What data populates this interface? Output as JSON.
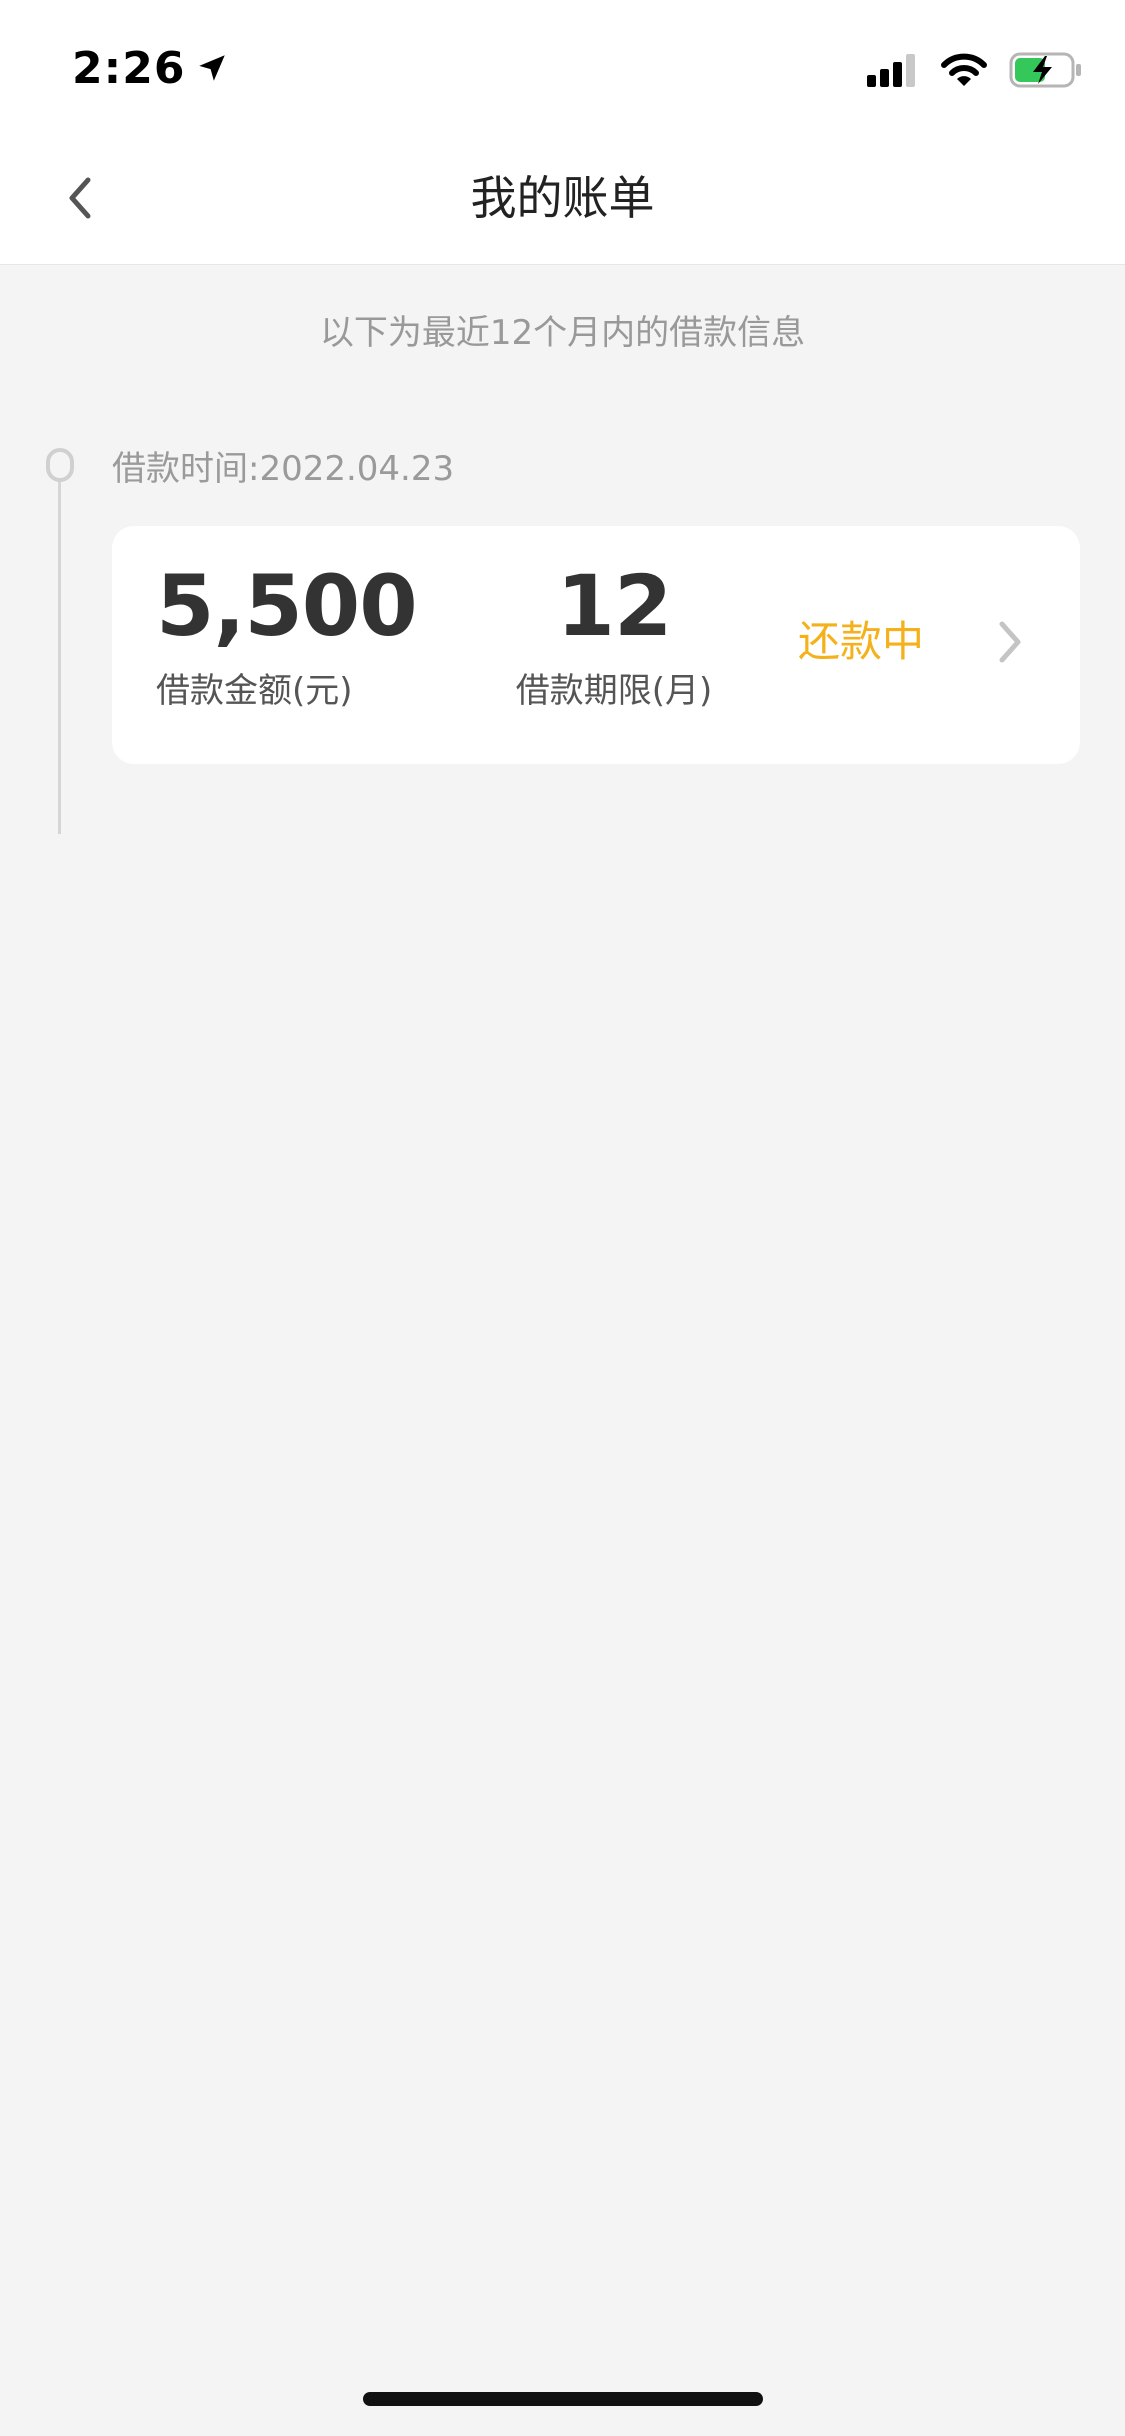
{
  "status_bar": {
    "time": "2:26",
    "icons": [
      "location-arrow-icon",
      "cellular-signal-icon",
      "wifi-icon",
      "battery-charging-icon"
    ],
    "battery_color": "#34c759"
  },
  "nav": {
    "title": "我的账单",
    "back_icon": "chevron-left-icon"
  },
  "info": {
    "subtitle": "以下为最近12个月内的借款信息"
  },
  "loans": [
    {
      "date_text": "借款时间:2022.04.23",
      "amount": "5,500",
      "amount_label": "借款金额(元)",
      "term": "12",
      "term_label": "借款期限(月)",
      "status": "还款中",
      "status_color": "#f5b11b"
    }
  ],
  "colors": {
    "background": "#f4f4f4",
    "card": "#ffffff",
    "accent": "#f5b11b"
  }
}
